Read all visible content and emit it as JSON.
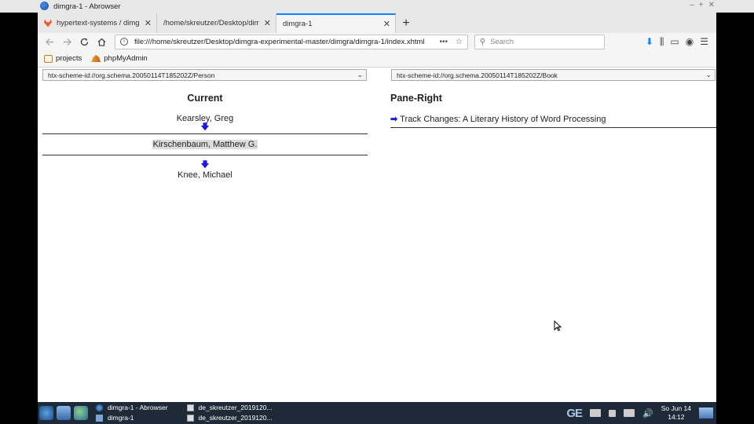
{
  "window": {
    "title": "dimgra-1 - Abrowser"
  },
  "tabs": [
    {
      "label": "hypertext-systems / dimgra-ex",
      "favicon": "gitlab-icon"
    },
    {
      "label": "/home/skreutzer/Desktop/dimgra"
    },
    {
      "label": "dimgra-1",
      "active": true
    }
  ],
  "navbar": {
    "url": "file:///home/skreutzer/Desktop/dimgra-experimental-master/dimgra/dimgra-1/index.xhtml",
    "search_placeholder": "Search"
  },
  "bookmarks": [
    {
      "label": "projects",
      "icon": "folder-icon"
    },
    {
      "label": "phpMyAdmin",
      "icon": "phpmyadmin-icon"
    }
  ],
  "left_pane": {
    "select_value": "htx-scheme-id://org.schema.20050114T185202Z/Person",
    "heading": "Current",
    "previous": "Kearsley, Greg",
    "current": "Kirschenbaum, Matthew G.",
    "next": "Knee, Michael"
  },
  "right_pane": {
    "select_value": "htx-scheme-id://org.schema.20050114T185202Z/Book",
    "heading": "Pane-Right",
    "book": "Track Changes: A Literary History of Word Processing"
  },
  "taskbar": {
    "tasks": [
      {
        "label": "dimgra-1 - Abrowser",
        "icon": "browser-icon"
      },
      {
        "label": "dimgra-1",
        "icon": "folder-icon"
      },
      {
        "label": "de_skreutzer_2019120...",
        "icon": "terminal-icon"
      },
      {
        "label": "de_skreutzer_2019120...",
        "icon": "terminal-icon"
      }
    ],
    "keyboard_layout": "GE",
    "clock_day": "So Jun 14",
    "clock_time": "14:12"
  }
}
